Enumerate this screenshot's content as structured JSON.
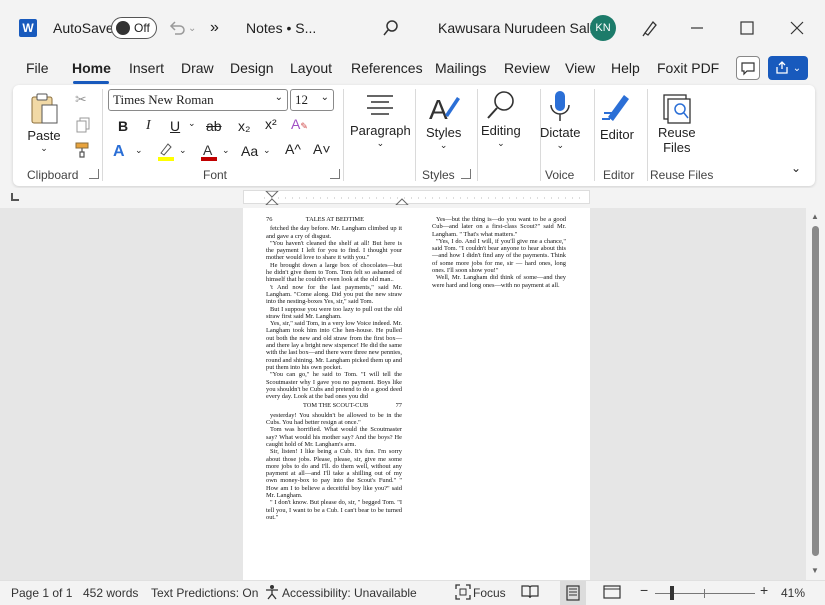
{
  "titlebar": {
    "autosave_label": "AutoSave",
    "autosave_state": "Off",
    "more": "»",
    "doc_title": "Notes • S...",
    "user_name": "Kawusara Nurudeen Salley",
    "user_initials": "KN"
  },
  "tabs": [
    "File",
    "Home",
    "Insert",
    "Draw",
    "Design",
    "Layout",
    "References",
    "Mailings",
    "Review",
    "View",
    "Help",
    "Foxit PDF"
  ],
  "ribbon": {
    "clipboard": {
      "paste": "Paste",
      "group": "Clipboard"
    },
    "font": {
      "name": "Times New Roman",
      "size": "12",
      "group": "Font",
      "bold": "B",
      "italic": "I",
      "underline": "U",
      "strike": "ab",
      "sub": "x₂",
      "sup": "x²",
      "case": "Aa",
      "grow": "A^",
      "shrink": "A˅",
      "effects": "A"
    },
    "paragraph": {
      "label": "Paragraph"
    },
    "styles": {
      "label": "Styles",
      "group": "Styles"
    },
    "editing": {
      "label": "Editing"
    },
    "voice": {
      "label": "Dictate",
      "group": "Voice"
    },
    "editor": {
      "label": "Editor",
      "group": "Editor"
    },
    "reuse": {
      "label1": "Reuse",
      "label2": "Files",
      "group": "Reuse Files"
    }
  },
  "document": {
    "left_header_num": "76",
    "left_header_title": "TALES AT BEDTIME",
    "left_paragraphs": [
      "fetched the day before. Mr. Langham climbed up it and gave a cry of disgust.",
      "\"You haven't cleaned the shelf at all! But here is the payment I left for you to find. I thought your mother would love to share it with you.\"",
      "He brought down a large box of chocolates—but he didn't give them to Tom. Tom felt so ashamed of himself that he couldn't even look at the old man..",
      "'t And now for the last payments,\" said Mr. Langham. \"Come along. Did you put the new straw into the nesting-boxes Yes, sir,\" said Tom.",
      "But I suppose you were too lazy to pull out the old straw first said Mr. Langham.",
      "Yes, sir,\" said Tom, in a very low Voice indeed. Mr. Langham took him into Che hen-house. He pulled out both the new and old straw from the first box—and there lay a bright new sixpence! He did the same with the last box—and there were three new pennies, round and shining. Mr. Langham picked them up and put them into his own pocket.",
      "\"You can go,\" he said to Tom. \"I will tell the Scoutmaster why I gave you no payment. Boys like you shouldn't be Cubs and pretend to do a good deed every day. Look at the bad ones you did"
    ],
    "mid_header_title": "TOM THE SCOUT-CUB",
    "mid_header_num": "77",
    "left_paragraphs_2": [
      "yesterday! You shouldn't be allowed to be in the Cubs. You had better resign at once.\"",
      "Tom was horrified. What would the Scoutmaster say? What would his mother say? And the boys? He caught hold of Mr. Langham's arm.",
      "Sir, listen! I like being a Cub. It's fun. I'm sorry about those jobs. Please, please, sir, give me some more jobs to do and I'll. do them well, without any payment at all—and I'll take a shilling out of my own money-box to pay into the Scout's Fund.\" \" How am I to believe a deceitful boy like you?\" said Mr. Langham.",
      "\" I don't know. But please do, sir, \" begged Tom. \"I tell you, I want to be a Cub. I can't bear to be turned out.\""
    ],
    "right_paragraphs": [
      "Yes—but the thing is—do you want to be a good Cub—and later on a first-class Scout?\" said Mr. Langham. \" That's what matters.\"",
      "\"Yes, I do. And I will, if you'll give me a chance,\" said Tom. \"I couldn't bear anyone to hear about this—and how I didn't find any of the payments. Think of some more jobs for me, sir — hard ones, long ones. I'll soon show you!\"",
      "Well, Mr. Langham did think of some—and they were hard and long ones—with no payment at all."
    ]
  },
  "status": {
    "page": "Page 1 of 1",
    "words": "452 words",
    "predictions": "Text Predictions: On",
    "accessibility": "Accessibility: Unavailable",
    "focus": "Focus",
    "zoom": "41%"
  },
  "colors": {
    "accent": "#185abd",
    "avatar": "#1c7b6a",
    "highlight": "#ffff00",
    "font_color": "#c00000"
  }
}
